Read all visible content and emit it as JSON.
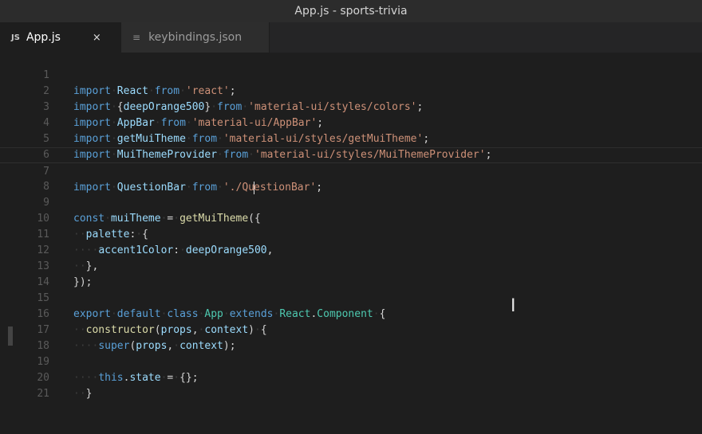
{
  "window": {
    "title": "App.js - sports-trivia"
  },
  "tabs": [
    {
      "icon_text": "JS",
      "label": "App.js",
      "close": "×",
      "active": true
    },
    {
      "icon_text": "≡",
      "label": "keybindings.json",
      "active": false
    }
  ],
  "editor": {
    "line_numbers": [
      "1",
      "2",
      "3",
      "4",
      "5",
      "6",
      "7",
      "8",
      "9",
      "10",
      "11",
      "12",
      "13",
      "14",
      "15",
      "16",
      "17",
      "18",
      "19",
      "20",
      "21"
    ]
  }
}
